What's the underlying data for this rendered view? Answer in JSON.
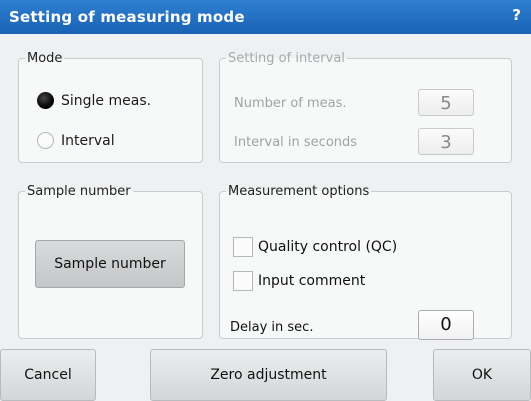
{
  "window": {
    "title": "Setting of measuring mode",
    "help_glyph": "?"
  },
  "mode": {
    "legend": "Mode",
    "options": [
      {
        "label": "Single meas.",
        "selected": true
      },
      {
        "label": "Interval",
        "selected": false
      }
    ]
  },
  "interval": {
    "legend": "Setting of interval",
    "number_label": "Number of meas.",
    "number_value": "5",
    "seconds_label": "Interval in seconds",
    "seconds_value": "3"
  },
  "sample": {
    "legend": "Sample number",
    "button_label": "Sample number"
  },
  "options": {
    "legend": "Measurement options",
    "qc_label": "Quality control (QC)",
    "qc_checked": false,
    "comment_label": "Input comment",
    "comment_checked": false,
    "delay_label": "Delay in sec.",
    "delay_value": "0"
  },
  "footer": {
    "cancel_label": "Cancel",
    "zero_label": "Zero adjustment",
    "ok_label": "OK"
  },
  "colors": {
    "titlebar": "#1f6cc0",
    "background": "#eef0f1"
  }
}
